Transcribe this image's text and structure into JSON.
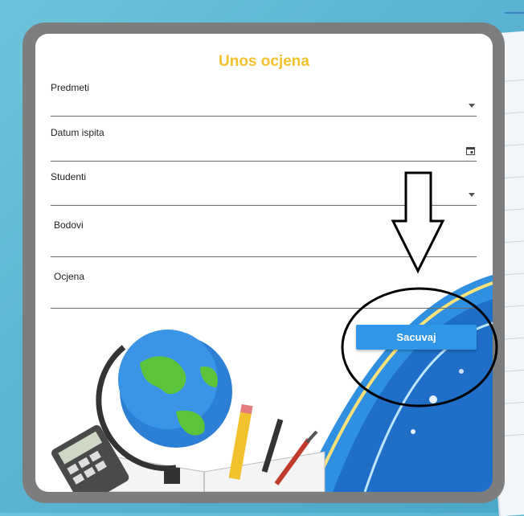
{
  "form": {
    "title": "Unos ocjena",
    "fields": {
      "predmeti": {
        "label": "Predmeti",
        "value": ""
      },
      "datum_ispita": {
        "label": "Datum ispita",
        "value": ""
      },
      "studenti": {
        "label": "Studenti",
        "value": ""
      },
      "bodovi": {
        "label": "Bodovi",
        "value": ""
      },
      "ocjena": {
        "label": "Ocjena",
        "value": ""
      }
    },
    "save_label": "Sacuvaj"
  },
  "colors": {
    "title": "#f2c12e",
    "button": "#2f96e8",
    "frame": "#7d7d7d",
    "background": "#5db5d2"
  },
  "icons": [
    "dropdown-caret-icon",
    "calendar-icon",
    "down-arrow-annotation",
    "circle-annotation"
  ]
}
